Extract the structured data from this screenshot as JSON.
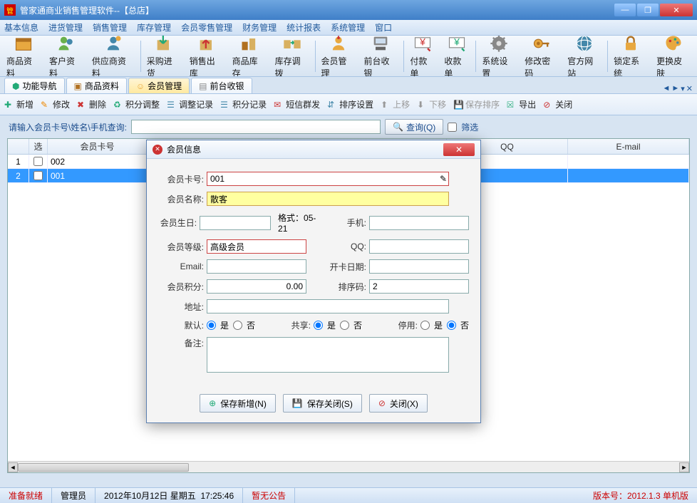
{
  "window": {
    "title": "管家通商业销售管理软件--【总店】"
  },
  "menu": [
    "基本信息",
    "进货管理",
    "销售管理",
    "库存管理",
    "会员零售管理",
    "财务管理",
    "统计报表",
    "系统管理",
    "窗口"
  ],
  "toolbar": [
    {
      "label": "商品资料"
    },
    {
      "label": "客户资料"
    },
    {
      "label": "供应商资料"
    },
    {
      "label": "采购进货"
    },
    {
      "label": "销售出库"
    },
    {
      "label": "商品库存"
    },
    {
      "label": "库存调拨"
    },
    {
      "label": "会员管理"
    },
    {
      "label": "前台收银"
    },
    {
      "label": "付款单"
    },
    {
      "label": "收款单"
    },
    {
      "label": "系统设置"
    },
    {
      "label": "修改密码"
    },
    {
      "label": "官方网站"
    },
    {
      "label": "锁定系统"
    },
    {
      "label": "更换皮肤"
    }
  ],
  "tabs": [
    {
      "label": "功能导航"
    },
    {
      "label": "商品资料"
    },
    {
      "label": "会员管理",
      "active": true
    },
    {
      "label": "前台收银"
    }
  ],
  "subtoolbar": {
    "add": "新增",
    "edit": "修改",
    "del": "删除",
    "pointsAdj": "积分调整",
    "adjLog": "调整记录",
    "pointsLog": "积分记录",
    "sms": "短信群发",
    "sort": "排序设置",
    "up": "上移",
    "down": "下移",
    "saveSort": "保存排序",
    "export": "导出",
    "close": "关闭"
  },
  "search": {
    "label": "请输入会员卡号\\姓名\\手机查询:",
    "value": "",
    "btn": "查询(Q)",
    "filter": "筛选"
  },
  "table": {
    "headers": {
      "sel": "选",
      "card": "会员卡号",
      "qq": "QQ",
      "email": "E-mail"
    },
    "rows": [
      {
        "idx": "1",
        "card": "002",
        "sel": false
      },
      {
        "idx": "2",
        "card": "001",
        "sel": false,
        "selected": true
      }
    ]
  },
  "dialog": {
    "title": "会员信息",
    "labels": {
      "card": "会员卡号:",
      "name": "会员名称:",
      "birthday": "会员生日:",
      "bdfmt": "格式：05-21",
      "phone": "手机:",
      "level": "会员等级:",
      "qq": "QQ:",
      "email": "Email:",
      "opendate": "开卡日期:",
      "points": "会员积分:",
      "sort": "排序码:",
      "addr": "地址:",
      "default": "默认:",
      "share": "共享:",
      "disable": "停用:",
      "remark": "备注:",
      "yes": "是",
      "no": "否"
    },
    "values": {
      "card": "001",
      "name": "散客",
      "birthday": "",
      "phone": "",
      "level": "高级会员",
      "qq": "",
      "email": "",
      "opendate": "",
      "points": "0.00",
      "sort": "2",
      "addr": "",
      "remark": "",
      "default": "yes",
      "share": "yes",
      "disable": "no"
    },
    "buttons": {
      "saveNew": "保存新增(N)",
      "saveClose": "保存关闭(S)",
      "close": "关闭(X)"
    }
  },
  "status": {
    "ready": "准备就绪",
    "user": "管理员",
    "date": "2012年10月12日 星期五",
    "time": "17:25:46",
    "notice": "暂无公告",
    "version": "版本号：2012.1.3 单机版"
  }
}
